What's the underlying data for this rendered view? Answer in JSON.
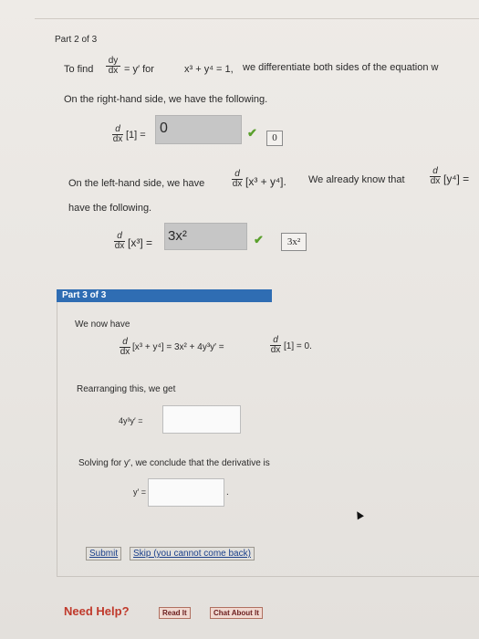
{
  "part2": {
    "header": "Part 2 of 3",
    "intro_prefix": "To find",
    "dy": "dy",
    "dx": "dx",
    "eq_yprime": "= y′  for",
    "equation": "x³ + y⁴ = 1,",
    "intro_suffix": "we differentiate both sides of the equation w",
    "rhs_intro": "On the right-hand side, we have the following.",
    "d": "d",
    "rhs_expr": "[1] =",
    "rhs_answer": "0",
    "rhs_correct": "0",
    "lhs_intro": "On the left-hand side, we have",
    "lhs_bracket": "[x³ + y⁴].",
    "lhs_know": "We already know that",
    "lhs_bracket2": "[y⁴] =",
    "lhs_have": "have the following.",
    "lhs_expr": "[x³] =",
    "lhs_answer": "3x²",
    "lhs_correct": "3x²"
  },
  "part3": {
    "header": "Part 3 of 3",
    "now_have": "We now have",
    "eq_left": "[x³ + y⁴] = 3x² + 4y³y′ =",
    "eq_right": "[1] = 0.",
    "rearrange": "Rearranging this, we get",
    "rearrange_lhs": "4y³y′ =",
    "rearrange_value": "",
    "solving": "Solving for y′, we conclude that the derivative is",
    "yprime_lhs": "y′ =",
    "yprime_value": "",
    "period": "."
  },
  "buttons": {
    "submit": "Submit",
    "skip": "Skip (you cannot come back)"
  },
  "help": {
    "label": "Need Help?",
    "read_it": "Read It",
    "chat": "Chat About It"
  },
  "colors": {
    "part_bar": "#2f6db3",
    "check": "#5aa02c",
    "need_help": "#c0392b"
  }
}
